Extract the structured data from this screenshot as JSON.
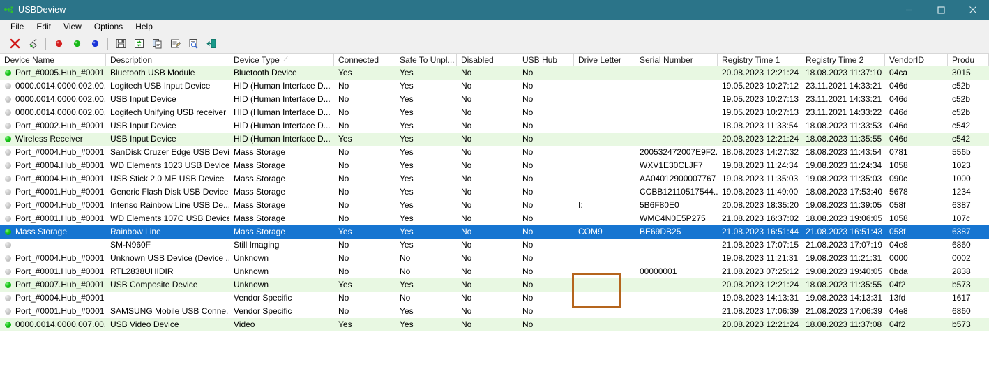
{
  "window": {
    "title": "USBDeview",
    "icon": "usb-icon",
    "minimize_label": "Minimize",
    "maximize_label": "Maximize",
    "close_label": "Close"
  },
  "menu": [
    {
      "label": "File"
    },
    {
      "label": "Edit"
    },
    {
      "label": "View"
    },
    {
      "label": "Options"
    },
    {
      "label": "Help"
    }
  ],
  "toolbar": [
    {
      "name": "uninstall-device-icon",
      "kind": "red-x"
    },
    {
      "name": "disconnect-device-icon",
      "kind": "plug-gray"
    },
    {
      "name": "sep",
      "kind": "sep"
    },
    {
      "name": "stop-device-icon",
      "kind": "ball-red"
    },
    {
      "name": "connect-device-icon",
      "kind": "ball-green"
    },
    {
      "name": "info-device-icon",
      "kind": "ball-blue"
    },
    {
      "name": "sep",
      "kind": "sep"
    },
    {
      "name": "save-icon",
      "kind": "floppy"
    },
    {
      "name": "refresh-icon",
      "kind": "refresh"
    },
    {
      "name": "copy-icon",
      "kind": "copy"
    },
    {
      "name": "properties-icon",
      "kind": "properties"
    },
    {
      "name": "html-report-icon",
      "kind": "report"
    },
    {
      "name": "exit-icon",
      "kind": "exit"
    }
  ],
  "columns": [
    {
      "label": "Device Name",
      "width": 152,
      "sorted": false
    },
    {
      "label": "Description",
      "width": 177,
      "sorted": false
    },
    {
      "label": "Device Type",
      "width": 150,
      "sorted": true
    },
    {
      "label": "Connected",
      "width": 88,
      "sorted": false
    },
    {
      "label": "Safe To Unpl...",
      "width": 88,
      "sorted": false
    },
    {
      "label": "Disabled",
      "width": 88,
      "sorted": false
    },
    {
      "label": "USB Hub",
      "width": 80,
      "sorted": false
    },
    {
      "label": "Drive Letter",
      "width": 88,
      "sorted": false
    },
    {
      "label": "Serial Number",
      "width": 118,
      "sorted": false
    },
    {
      "label": "Registry Time 1",
      "width": 120,
      "sorted": false
    },
    {
      "label": "Registry Time 2",
      "width": 120,
      "sorted": false
    },
    {
      "label": "VendorID",
      "width": 90,
      "sorted": false
    },
    {
      "label": "Produ",
      "width": 59,
      "sorted": false
    }
  ],
  "sort_indicator": "⁄",
  "rows": [
    {
      "status": "on",
      "selected": false,
      "alt": true,
      "cells": [
        "Port_#0005.Hub_#0001",
        "Bluetooth USB Module",
        "Bluetooth Device",
        "Yes",
        "Yes",
        "No",
        "No",
        "",
        "",
        "20.08.2023 12:21:24",
        "18.08.2023 11:37:10",
        "04ca",
        "3015"
      ]
    },
    {
      "status": "off",
      "selected": false,
      "alt": false,
      "cells": [
        "0000.0014.0000.002.00...",
        "Logitech USB Input Device",
        "HID (Human Interface D...",
        "No",
        "Yes",
        "No",
        "No",
        "",
        "",
        "19.05.2023 10:27:12",
        "23.11.2021 14:33:21",
        "046d",
        "c52b"
      ]
    },
    {
      "status": "off",
      "selected": false,
      "alt": false,
      "cells": [
        "0000.0014.0000.002.00...",
        "USB Input Device",
        "HID (Human Interface D...",
        "No",
        "Yes",
        "No",
        "No",
        "",
        "",
        "19.05.2023 10:27:13",
        "23.11.2021 14:33:21",
        "046d",
        "c52b"
      ]
    },
    {
      "status": "off",
      "selected": false,
      "alt": false,
      "cells": [
        "0000.0014.0000.002.00...",
        "Logitech Unifying USB receiver",
        "HID (Human Interface D...",
        "No",
        "Yes",
        "No",
        "No",
        "",
        "",
        "19.05.2023 10:27:13",
        "23.11.2021 14:33:22",
        "046d",
        "c52b"
      ]
    },
    {
      "status": "off",
      "selected": false,
      "alt": false,
      "cells": [
        "Port_#0002.Hub_#0001",
        "USB Input Device",
        "HID (Human Interface D...",
        "No",
        "Yes",
        "No",
        "No",
        "",
        "",
        "18.08.2023 11:33:54",
        "18.08.2023 11:33:53",
        "046d",
        "c542"
      ]
    },
    {
      "status": "on",
      "selected": false,
      "alt": true,
      "cells": [
        "Wireless Receiver",
        "USB Input Device",
        "HID (Human Interface D...",
        "Yes",
        "Yes",
        "No",
        "No",
        "",
        "",
        "20.08.2023 12:21:24",
        "18.08.2023 11:35:55",
        "046d",
        "c542"
      ]
    },
    {
      "status": "off",
      "selected": false,
      "alt": false,
      "cells": [
        "Port_#0004.Hub_#0001",
        "SanDisk Cruzer Edge USB Devi...",
        "Mass Storage",
        "No",
        "Yes",
        "No",
        "No",
        "",
        "200532472007E9F2...",
        "18.08.2023 14:27:32",
        "18.08.2023 11:43:54",
        "0781",
        "556b"
      ]
    },
    {
      "status": "off",
      "selected": false,
      "alt": false,
      "cells": [
        "Port_#0004.Hub_#0001",
        "WD Elements 1023 USB Device",
        "Mass Storage",
        "No",
        "Yes",
        "No",
        "No",
        "",
        "WXV1E30CLJF7",
        "19.08.2023 11:24:34",
        "19.08.2023 11:24:34",
        "1058",
        "1023"
      ]
    },
    {
      "status": "off",
      "selected": false,
      "alt": false,
      "cells": [
        "Port_#0004.Hub_#0001",
        "USB Stick 2.0 ME USB Device",
        "Mass Storage",
        "No",
        "Yes",
        "No",
        "No",
        "",
        "AA04012900007767",
        "19.08.2023 11:35:03",
        "19.08.2023 11:35:03",
        "090c",
        "1000"
      ]
    },
    {
      "status": "off",
      "selected": false,
      "alt": false,
      "cells": [
        "Port_#0001.Hub_#0001",
        "Generic Flash Disk USB Device",
        "Mass Storage",
        "No",
        "Yes",
        "No",
        "No",
        "",
        "CCBB12110517544...",
        "19.08.2023 11:49:00",
        "18.08.2023 17:53:40",
        "5678",
        "1234"
      ]
    },
    {
      "status": "off",
      "selected": false,
      "alt": false,
      "cells": [
        "Port_#0004.Hub_#0001",
        "Intenso Rainbow Line USB De...",
        "Mass Storage",
        "No",
        "Yes",
        "No",
        "No",
        "I:",
        "5B6F80E0",
        "20.08.2023 18:35:20",
        "19.08.2023 11:39:05",
        "058f",
        "6387"
      ]
    },
    {
      "status": "off",
      "selected": false,
      "alt": false,
      "cells": [
        "Port_#0001.Hub_#0001",
        "WD Elements 107C USB Device",
        "Mass Storage",
        "No",
        "Yes",
        "No",
        "No",
        "",
        "WMC4N0E5P275",
        "21.08.2023 16:37:02",
        "18.08.2023 19:06:05",
        "1058",
        "107c"
      ]
    },
    {
      "status": "on",
      "selected": true,
      "alt": false,
      "cells": [
        "Mass Storage",
        "Rainbow Line",
        "Mass Storage",
        "Yes",
        "Yes",
        "No",
        "No",
        "COM9",
        "BE69DB25",
        "21.08.2023 16:51:44",
        "21.08.2023 16:51:43",
        "058f",
        "6387"
      ]
    },
    {
      "status": "off",
      "selected": false,
      "alt": false,
      "cells": [
        "",
        "SM-N960F",
        "Still Imaging",
        "No",
        "Yes",
        "No",
        "No",
        "",
        "",
        "21.08.2023 17:07:15",
        "21.08.2023 17:07:19",
        "04e8",
        "6860"
      ]
    },
    {
      "status": "off",
      "selected": false,
      "alt": false,
      "cells": [
        "Port_#0004.Hub_#0001",
        "Unknown USB Device (Device ...",
        "Unknown",
        "No",
        "No",
        "No",
        "No",
        "",
        "",
        "19.08.2023 11:21:31",
        "19.08.2023 11:21:31",
        "0000",
        "0002"
      ]
    },
    {
      "status": "off",
      "selected": false,
      "alt": false,
      "cells": [
        "Port_#0001.Hub_#0001",
        "RTL2838UHIDIR",
        "Unknown",
        "No",
        "No",
        "No",
        "No",
        "",
        "00000001",
        "21.08.2023 07:25:12",
        "19.08.2023 19:40:05",
        "0bda",
        "2838"
      ]
    },
    {
      "status": "on",
      "selected": false,
      "alt": true,
      "cells": [
        "Port_#0007.Hub_#0001",
        "USB Composite Device",
        "Unknown",
        "Yes",
        "Yes",
        "No",
        "No",
        "",
        "",
        "20.08.2023 12:21:24",
        "18.08.2023 11:35:55",
        "04f2",
        "b573"
      ]
    },
    {
      "status": "off",
      "selected": false,
      "alt": false,
      "cells": [
        "Port_#0004.Hub_#0001",
        "",
        "Vendor Specific",
        "No",
        "No",
        "No",
        "No",
        "",
        "",
        "19.08.2023 14:13:31",
        "19.08.2023 14:13:31",
        "13fd",
        "1617"
      ]
    },
    {
      "status": "off",
      "selected": false,
      "alt": false,
      "cells": [
        "Port_#0001.Hub_#0001",
        "SAMSUNG Mobile USB Conne...",
        "Vendor Specific",
        "No",
        "Yes",
        "No",
        "No",
        "",
        "",
        "21.08.2023 17:06:39",
        "21.08.2023 17:06:39",
        "04e8",
        "6860"
      ]
    },
    {
      "status": "on",
      "selected": false,
      "alt": true,
      "cells": [
        "0000.0014.0000.007.00...",
        "USB Video Device",
        "Video",
        "Yes",
        "Yes",
        "No",
        "No",
        "",
        "",
        "20.08.2023 12:21:24",
        "18.08.2023 11:37:08",
        "04f2",
        "b573"
      ]
    }
  ],
  "annotation": {
    "name": "com-port-highlight",
    "color": "#b5651d",
    "target_text": "COM9"
  },
  "colors": {
    "titlebar": "#2b7489",
    "selection": "#1675d1",
    "alt_row": "#e8f8e2",
    "annotation": "#b5651d"
  }
}
